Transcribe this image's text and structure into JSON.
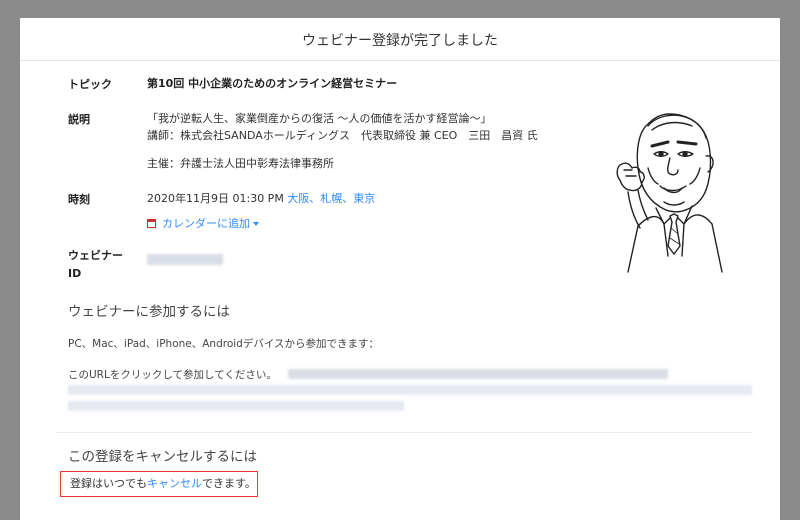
{
  "page": {
    "title": "ウェビナー登録が完了しました"
  },
  "topic": {
    "label": "トピック",
    "value": "第10回 中小企業のためのオンライン経営セミナー"
  },
  "description": {
    "label": "説明",
    "line1": "「我が逆転人生、家業倒産からの復活 ～人の価値を活かす経営論～」",
    "line2": "講師：株式会社SANDAホールディングス　代表取締役 兼 CEO　三田　昌資 氏",
    "line3": "主催：弁護士法人田中彰寿法律事務所"
  },
  "time": {
    "label": "時刻",
    "value": "2020年11月9日 01:30 PM",
    "timezone": "大阪、札幌、東京",
    "calendar_link": "カレンダーに追加"
  },
  "webinar_id": {
    "label": "ウェビナーID",
    "value": "▯▯▯ ▯▯▯▯ ▯▯▯▯"
  },
  "join": {
    "title": "ウェビナーに参加するには",
    "devices": "PC、Mac、iPad、iPhone、Androidデバイスから参加できます：",
    "url_prompt": "このURLをクリックして参加してください。"
  },
  "cancel": {
    "title": "この登録をキャンセルするには",
    "text_before": "登録はいつでも",
    "link": "キャンセル",
    "text_after": "できます。"
  },
  "colors": {
    "link": "#2d8cff",
    "highlight_border": "#e53935",
    "background": "#8a8a8a"
  },
  "icons": {
    "calendar": "calendar-icon",
    "caret": "chevron-down-icon",
    "illustration": "presenter-caricature"
  }
}
